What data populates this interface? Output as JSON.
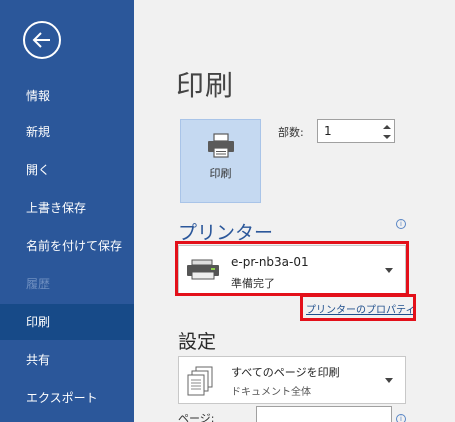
{
  "sidebar": {
    "items": [
      {
        "label": "情報"
      },
      {
        "label": "新規"
      },
      {
        "label": "開く"
      },
      {
        "label": "上書き保存"
      },
      {
        "label": "名前を付けて保存"
      },
      {
        "label": "履歴"
      },
      {
        "label": "印刷"
      },
      {
        "label": "共有"
      },
      {
        "label": "エクスポート"
      }
    ],
    "selected_index": 6,
    "disabled_index": 5
  },
  "main": {
    "title": "印刷",
    "print_button_label": "印刷",
    "copies_label": "部数:",
    "copies_value": "1",
    "printer_heading": "プリンター",
    "printer_name": "e-pr-nb3a-01",
    "printer_status": "準備完了",
    "printer_properties_link": "プリンターのプロパティ",
    "settings_heading": "設定",
    "settings_option_title": "すべてのページを印刷",
    "settings_option_sub": "ドキュメント全体",
    "pages_label": "ページ:",
    "info_glyph": "i"
  },
  "colors": {
    "sidebar_bg": "#2b579a",
    "sidebar_selected": "#174a88",
    "highlight_red": "#e3101a",
    "accent_blue": "#2b579a"
  },
  "icons": [
    "back-arrow-icon",
    "printer-icon",
    "spin-up-icon",
    "spin-down-icon",
    "info-icon",
    "printer-device-icon",
    "chevron-down-icon",
    "pages-icon"
  ]
}
